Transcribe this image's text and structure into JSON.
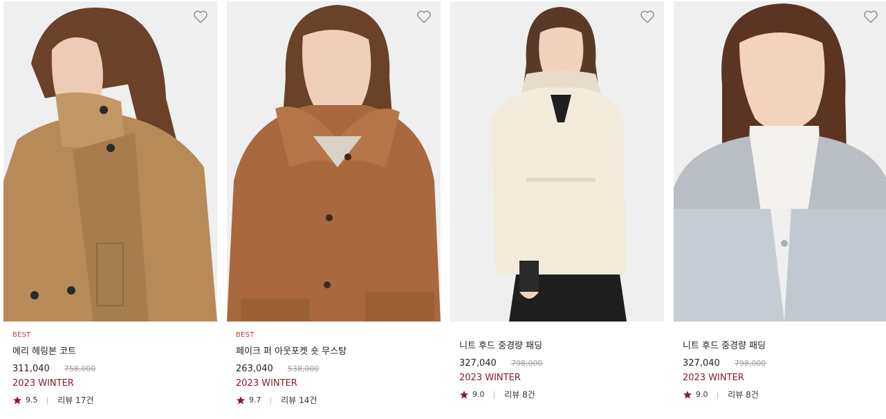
{
  "colors": {
    "badge": "#d1343f",
    "season": "#8a1a2d",
    "star": "#8a1a2d",
    "original_price": "#9b9b9b"
  },
  "products": [
    {
      "badge": "BEST",
      "name": "메리 헤링본 코트",
      "price": "311,040",
      "original_price": "758,000",
      "season": "2023 WINTER",
      "rating": "9.5",
      "separator": "|",
      "reviews": "리뷰 17건",
      "wish_icon": "heart-outline-icon",
      "rating_icon": "star-icon"
    },
    {
      "badge": "BEST",
      "name": "페이크 퍼 아웃포켓 숏 무스탕",
      "price": "263,040",
      "original_price": "538,000",
      "season": "2023 WINTER",
      "rating": "9.7",
      "separator": "|",
      "reviews": "리뷰 14건",
      "wish_icon": "heart-outline-icon",
      "rating_icon": "star-icon"
    },
    {
      "badge": "",
      "name": "니트 후드 중경량 패딩",
      "price": "327,040",
      "original_price": "798,000",
      "season": "2023 WINTER",
      "rating": "9.0",
      "separator": "|",
      "reviews": "리뷰 8건",
      "wish_icon": "heart-outline-icon",
      "rating_icon": "star-icon"
    },
    {
      "badge": "",
      "name": "니트 후드 중경량 패딩",
      "price": "327,040",
      "original_price": "798,000",
      "season": "2023 WINTER",
      "rating": "9.0",
      "separator": "|",
      "reviews": "리뷰 8건",
      "wish_icon": "heart-outline-icon",
      "rating_icon": "star-icon"
    }
  ]
}
